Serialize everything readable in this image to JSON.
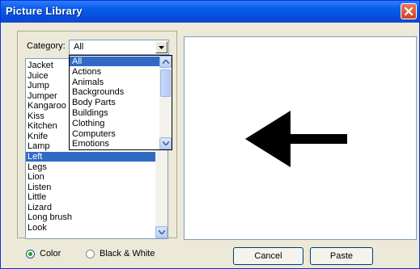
{
  "window": {
    "title": "Picture Library"
  },
  "category": {
    "label": "Category:",
    "value": "All"
  },
  "words": [
    "Jacket",
    "Juice",
    "Jump",
    "Jumper",
    "Kangaroo",
    "Kiss",
    "Kitchen",
    "Knife",
    "Lamp",
    "Left",
    "Legs",
    "Lion",
    "Listen",
    "Little",
    "Lizard",
    "Long brush",
    "Look"
  ],
  "selected_word": "Left",
  "category_options": [
    "All",
    "Actions",
    "Animals",
    "Backgrounds",
    "Body Parts",
    "Buildings",
    "Clothing",
    "Computers",
    "Emotions"
  ],
  "selected_category": "All",
  "preview": {
    "icon": "left-arrow-icon"
  },
  "mode": {
    "color_label": "Color",
    "bw_label": "Black & White",
    "selected": "color"
  },
  "buttons": {
    "cancel": "Cancel",
    "paste": "Paste"
  },
  "colors": {
    "titlebar": "#0a5de8",
    "selection": "#316ac5",
    "dialog_bg": "#ece9d8"
  }
}
